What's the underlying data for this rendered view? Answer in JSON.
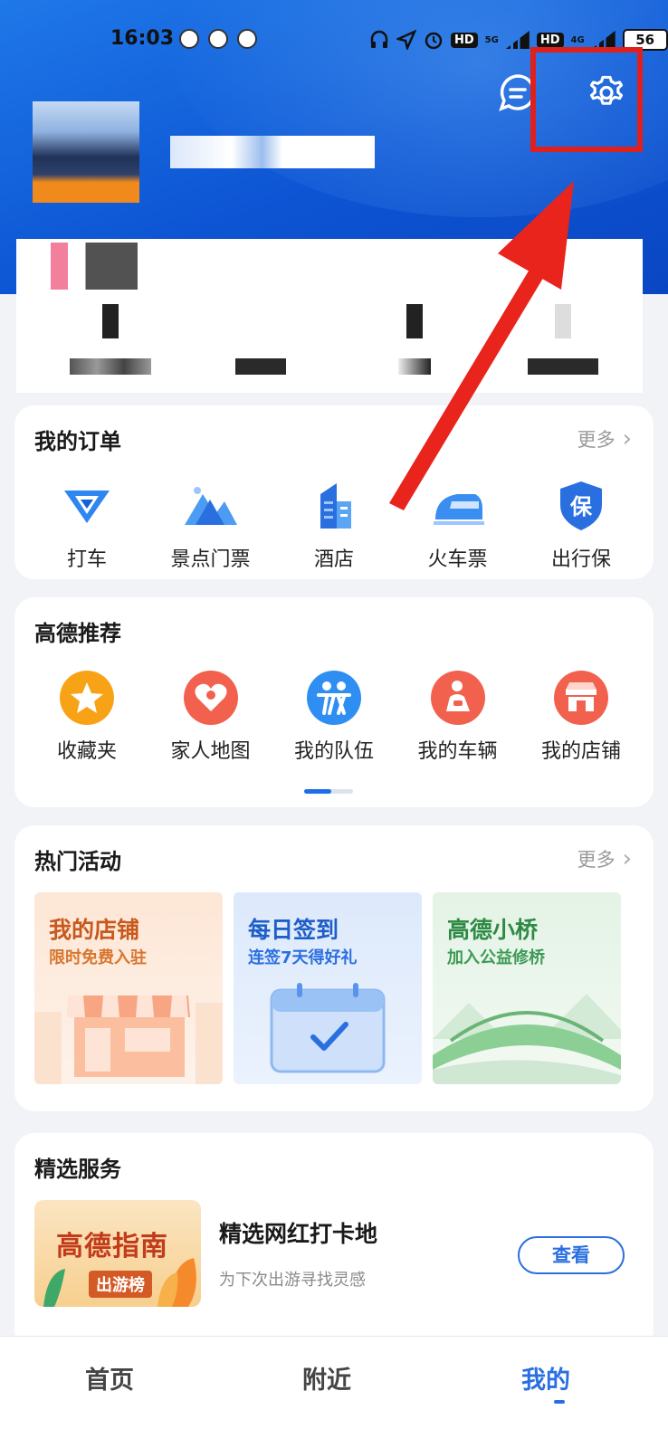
{
  "status_bar": {
    "time": "16:03",
    "sig1": "HD",
    "sig2": "HD",
    "net1": "5G",
    "net2": "4G",
    "battery": "56"
  },
  "header": {
    "message_icon": "message-icon",
    "settings_icon": "gear-icon"
  },
  "orders": {
    "title": "我的订单",
    "more": "更多",
    "items": [
      {
        "label": "打车",
        "icon": "taxi-icon"
      },
      {
        "label": "景点门票",
        "icon": "mountain-icon"
      },
      {
        "label": "酒店",
        "icon": "hotel-icon"
      },
      {
        "label": "火车票",
        "icon": "train-icon"
      },
      {
        "label": "出行保",
        "icon": "shield-icon"
      }
    ]
  },
  "recommend": {
    "title": "高德推荐",
    "items": [
      {
        "label": "收藏夹",
        "icon": "star-icon"
      },
      {
        "label": "家人地图",
        "icon": "heart-icon"
      },
      {
        "label": "我的队伍",
        "icon": "team-icon"
      },
      {
        "label": "我的车辆",
        "icon": "car-icon"
      },
      {
        "label": "我的店铺",
        "icon": "shop-icon"
      }
    ]
  },
  "activities": {
    "title": "热门活动",
    "more": "更多",
    "items": [
      {
        "title": "我的店铺",
        "subtitle": "限时免费入驻"
      },
      {
        "title": "每日签到",
        "subtitle": "连签7天得好礼"
      },
      {
        "title": "高德小桥",
        "subtitle": "加入公益修桥"
      }
    ]
  },
  "services": {
    "title": "精选服务",
    "thumb_title": "高德指南",
    "thumb_badge": "出游榜",
    "item_title": "精选网红打卡地",
    "item_subtitle": "为下次出游寻找灵感",
    "button": "查看"
  },
  "bottom_nav": {
    "home": "首页",
    "nearby": "附近",
    "mine": "我的"
  },
  "colors": {
    "primary": "#2a6fe0",
    "header": "#0d55d4",
    "highlight": "#e0201c"
  }
}
